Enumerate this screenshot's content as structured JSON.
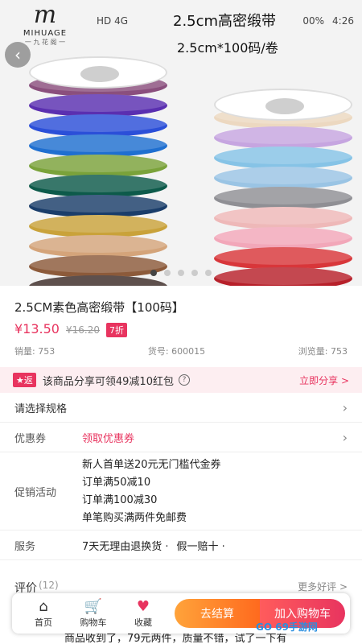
{
  "status_bar": {
    "left": "HD 4G",
    "signal": "⊙",
    "battery": "00%",
    "time": "4:26"
  },
  "logo": {
    "mark": "m",
    "name": "MIHUAGE",
    "sub": "一 九 花 阁 一"
  },
  "image_overlay": {
    "title": "2.5cm高密缎带",
    "size": "2.5cm*100码/卷"
  },
  "carousel": {
    "count": 5,
    "active": 0
  },
  "product": {
    "title": "2.5CM素色高密缎带【100码】",
    "price": "¥13.50",
    "old_price": "¥16.20",
    "discount": "7折",
    "sales": "销量: 753",
    "sku": "货号: 600015",
    "views": "浏览量: 753"
  },
  "share": {
    "badge": "★返",
    "text": "该商品分享可领49减10红包",
    "help": "?",
    "action": "立即分享 >"
  },
  "spec": {
    "label": "请选择规格"
  },
  "coupon": {
    "label": "优惠券",
    "action": "领取优惠券"
  },
  "promotion": {
    "label": "促销活动",
    "items": [
      "新人首单送20元无门槛代金券",
      "订单满50减10",
      "订单满100减30",
      "单笔购买满两件免邮费"
    ]
  },
  "service": {
    "label": "服务",
    "items": [
      "7天无理由退换货 ·",
      "假一赔十 ·"
    ]
  },
  "reviews": {
    "label": "评价",
    "count": "(12)",
    "more": "更多好评 >",
    "text": "商品收到了，79元两件，质量不错，试了一下有"
  },
  "bottom_bar": {
    "home": "首页",
    "cart": "购物车",
    "favorite": "收藏",
    "checkout": "去结算",
    "add_to_cart": "加入购物车"
  },
  "watermark": "GO 69手游网",
  "colors": {
    "accent": "#e8345f",
    "checkout": "#ff8a2b"
  },
  "icons": [
    "back-icon",
    "home-icon",
    "cart-icon",
    "heart-icon",
    "chevron-right-icon",
    "help-icon"
  ]
}
